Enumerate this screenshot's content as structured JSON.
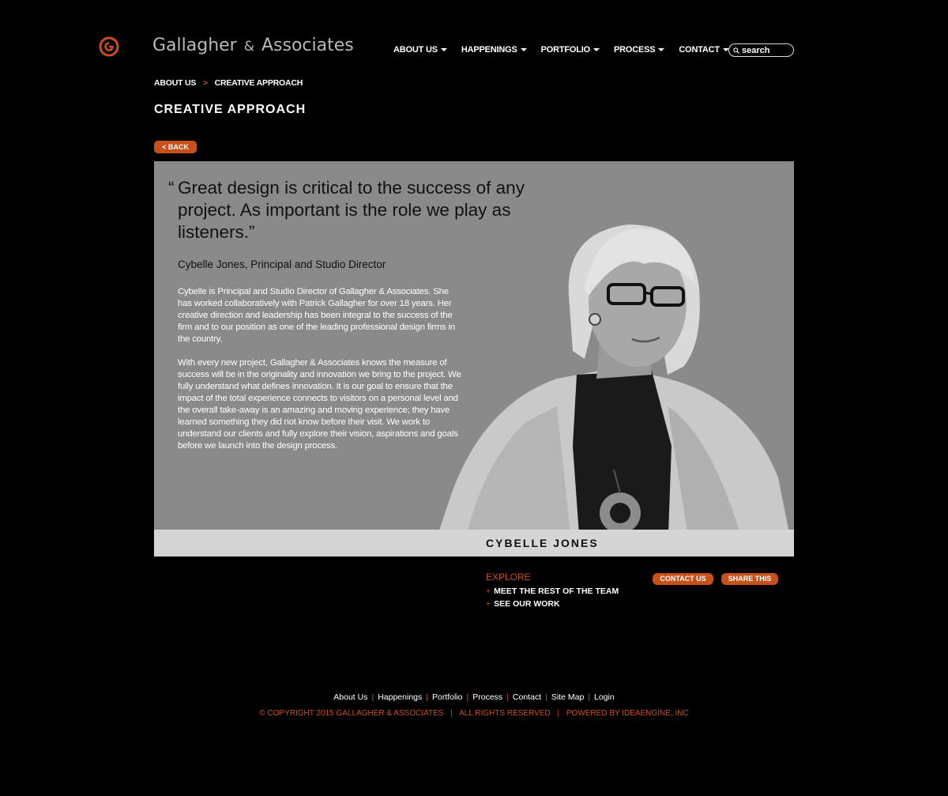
{
  "header": {
    "brand_name": "Gallagher",
    "brand_amp": "&",
    "brand_suffix": "Associates",
    "nav": [
      "ABOUT US",
      "HAPPENINGS",
      "PORTFOLIO",
      "PROCESS",
      "CONTACT"
    ],
    "search_placeholder": "search"
  },
  "breadcrumb": {
    "parent": "ABOUT US",
    "separator": ">",
    "current": "CREATIVE APPROACH"
  },
  "page_title": "CREATIVE APPROACH",
  "back_label": "< BACK",
  "profile": {
    "quote_open": "“",
    "quote": "Great design is critical to the success of any project. As important is the role we play as listeners.”",
    "attribution": "Cybelle Jones, Principal and Studio Director",
    "bio_1": "Cybelle is Principal and Studio Director of Gallagher & Associates. She has worked collaboratively with Patrick Gallagher for over 18 years.  Her creative direction and leadership has been integral to the success of the firm and to our position as one of the leading professional design firms in the country.",
    "bio_2": "With every new project, Gallagher & Associates knows the measure of success will be in the originality and innovation we bring to the project. We fully understand what defines innovation. It is our goal to ensure that the impact of the total experience connects to visitors on a personal level and the overall take-away is an amazing and moving experience; they have learned something they did not know before their visit. We work to understand our clients and fully explore their vision, aspirations and goals before we launch into the design process.",
    "name": "CYBELLE JONES"
  },
  "explore": {
    "heading": "EXPLORE",
    "plus": "+",
    "links": [
      "MEET THE REST OF THE TEAM",
      "SEE OUR WORK"
    ]
  },
  "actions": {
    "contact": "CONTACT US",
    "share": "SHARE THIS"
  },
  "footer": {
    "links": [
      "About Us",
      "Happenings",
      "Portfolio",
      "Process",
      "Contact",
      "Site Map",
      "Login"
    ],
    "sep": "|",
    "copyright": "© COPYRIGHT 2015 GALLAGHER & ASSOCIATES",
    "rights": "ALL RIGHTS RESERVED",
    "powered": "POWERED BY  IDEAENGINE, INC"
  },
  "colors": {
    "accent": "#c8501a",
    "background": "#000000",
    "panel": "#8a8a8a",
    "name_band": "#d6d6d6"
  }
}
